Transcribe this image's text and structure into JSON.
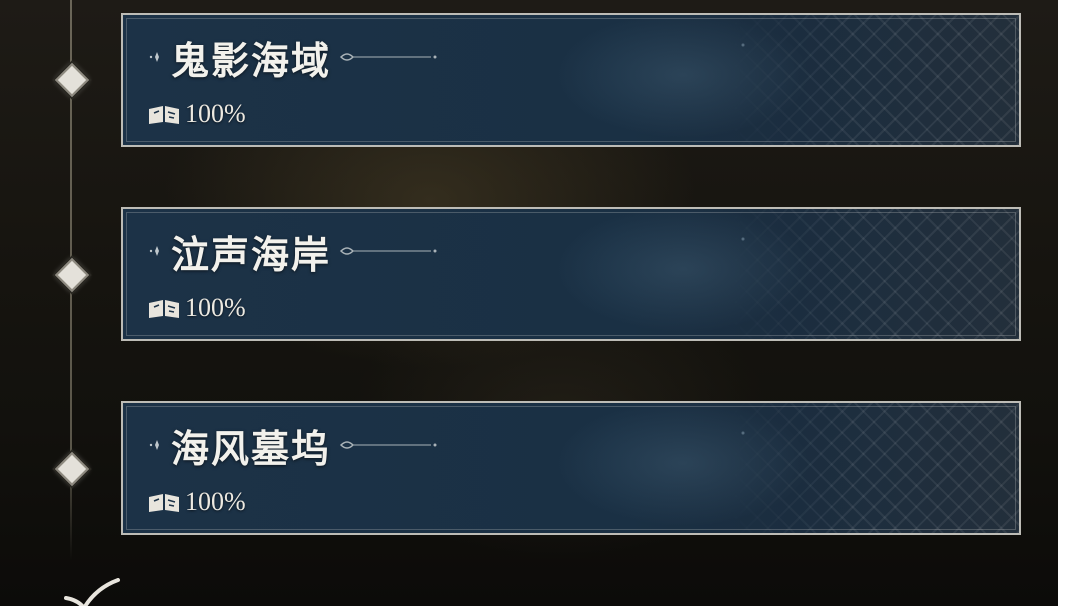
{
  "regions": [
    {
      "name": "鬼影海域",
      "progress": "100%"
    },
    {
      "name": "泣声海岸",
      "progress": "100%"
    },
    {
      "name": "海风墓坞",
      "progress": "100%"
    }
  ],
  "icons": {
    "title_left": "sparkle-diamond-icon",
    "title_right": "flourish-line-icon",
    "progress": "open-book-map-icon",
    "node": "diamond-node-icon",
    "bottom": "checkmark-icon"
  },
  "colors": {
    "card_bg": "#1c3247",
    "card_border": "#bdbcb6",
    "text": "#f2f1ec",
    "background": "#16140f"
  }
}
